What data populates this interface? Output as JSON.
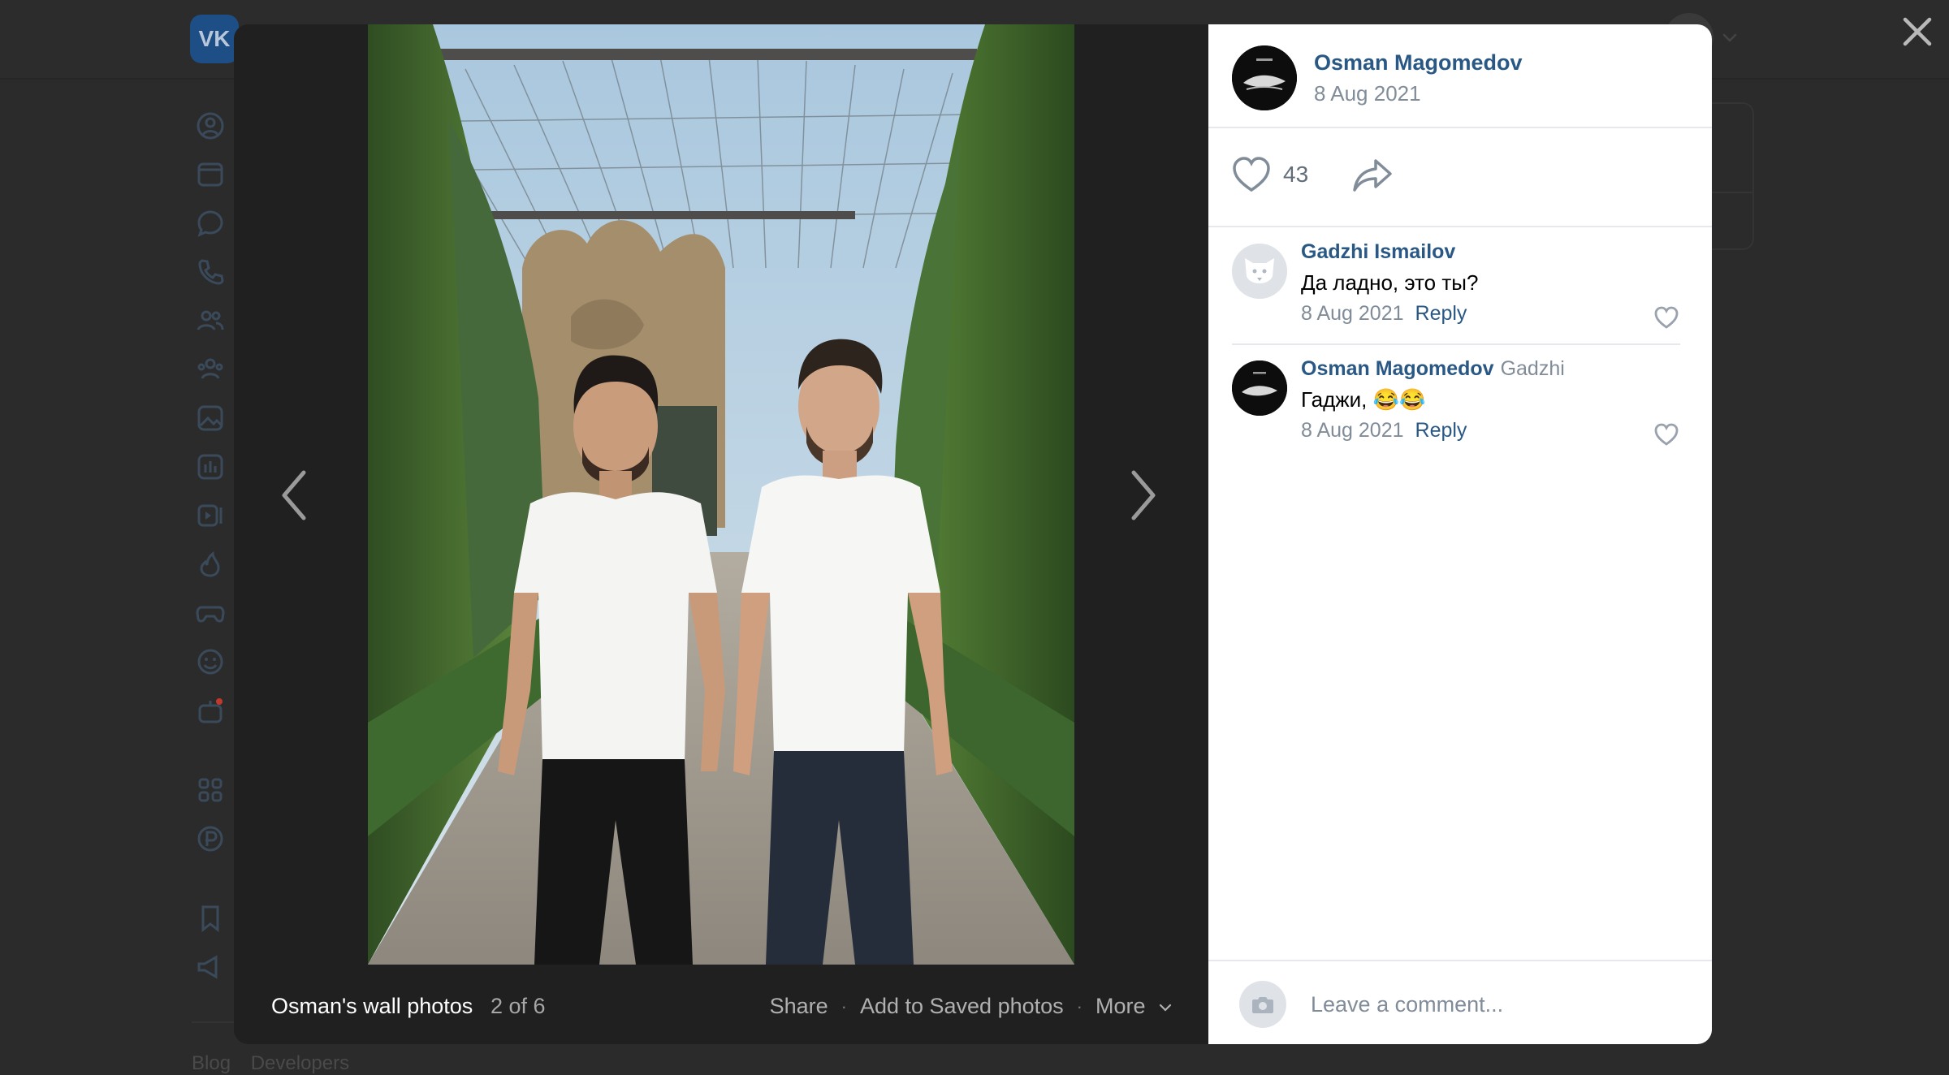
{
  "brand": {
    "logo_text": "VK"
  },
  "background": {
    "sidebar_icons": [
      "profile-icon",
      "news-icon",
      "messenger-icon",
      "calls-icon",
      "friends-icon",
      "communities-icon",
      "photos-icon",
      "music-icon",
      "video-icon",
      "clips-icon",
      "games-icon",
      "stickers-icon",
      "gifts-icon",
      "apps-icon",
      "payments-icon",
      "bookmarks-icon",
      "ads-icon"
    ],
    "footer_links": [
      "Blog",
      "Developers"
    ]
  },
  "viewer": {
    "album_title": "Osman's wall photos",
    "counter": "2 of 6",
    "actions": {
      "share": "Share",
      "save": "Add to Saved photos",
      "more": "More"
    }
  },
  "post": {
    "author": "Osman Magomedov",
    "date": "8 Aug 2021",
    "likes": "43"
  },
  "comments": [
    {
      "author": "Gadzhi Ismailov",
      "reply_to": "",
      "text": "Да ладно, это ты?",
      "date": "8 Aug 2021",
      "reply_label": "Reply"
    },
    {
      "author": "Osman Magomedov",
      "reply_to": "Gadzhi",
      "text": "Гаджи, 😂😂",
      "date": "8 Aug 2021",
      "reply_label": "Reply"
    }
  ],
  "composer": {
    "placeholder": "Leave a comment..."
  },
  "colors": {
    "link": "#2a5885",
    "muted": "#818c99",
    "accent": "#1d4e86"
  }
}
